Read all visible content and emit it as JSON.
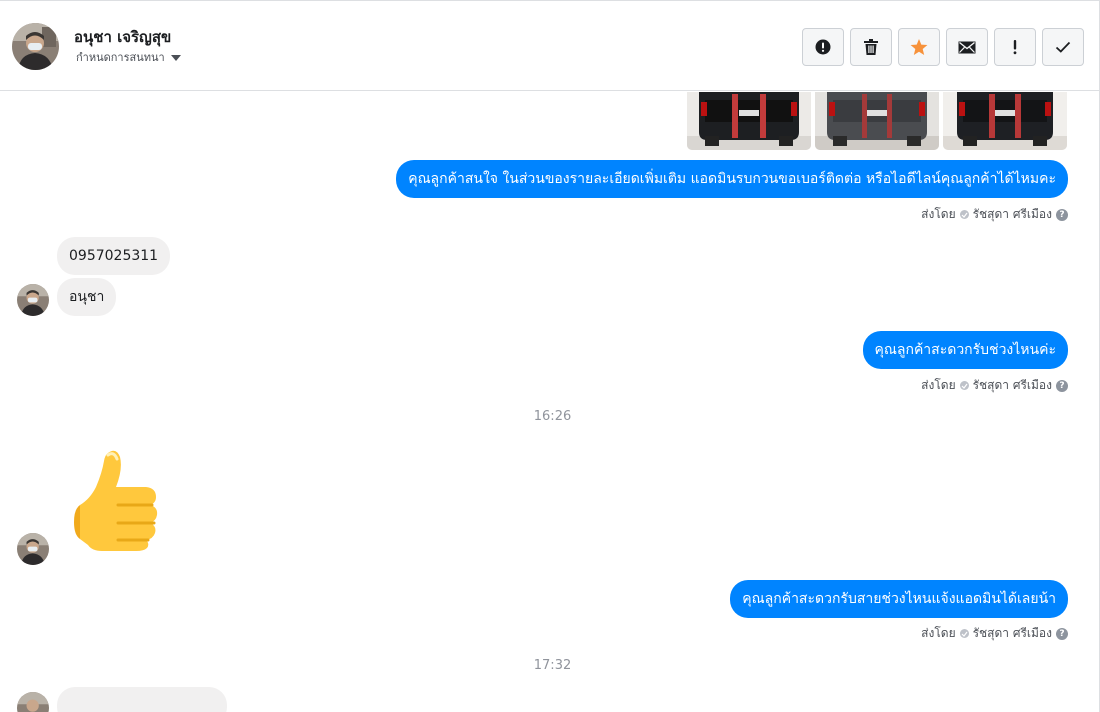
{
  "header": {
    "contact_name": "อนุชา เจริญสุข",
    "assign_label": "กำหนดการสนทนา"
  },
  "toolbar": {
    "buttons": [
      {
        "icon": "alert-circle-icon"
      },
      {
        "icon": "trash-icon"
      },
      {
        "icon": "star-icon",
        "color": "#f7923b"
      },
      {
        "icon": "envelope-icon"
      },
      {
        "icon": "exclamation-icon"
      },
      {
        "icon": "checkmark-icon"
      }
    ]
  },
  "thread": {
    "photos": [
      {
        "name": "black-pickup-truck-rear-photo-1"
      },
      {
        "name": "gray-pickup-truck-rear-photo"
      },
      {
        "name": "black-pickup-truck-rear-photo-2"
      }
    ],
    "messages": [
      {
        "direction": "out",
        "text": "คุณลูกค้าสนใจ ในส่วนของรายละเอียดเพิ่มเติม แอดมินรบกวนขอเบอร์ติดต่อ หรือไอดีไลน์คุณลูกค้าได้ไหมคะ",
        "sent_by_label": "ส่งโดย",
        "sender": "รัชสุดา ศรีเมือง"
      },
      {
        "direction": "in",
        "text": "0957025311"
      },
      {
        "direction": "in",
        "text": "อนุชา"
      },
      {
        "direction": "out",
        "text": "คุณลูกค้าสะดวกรับช่วงไหนค่ะ",
        "sent_by_label": "ส่งโดย",
        "sender": "รัชสุดา ศรีเมือง"
      },
      {
        "direction": "time",
        "text": "16:26"
      },
      {
        "direction": "in",
        "sticker": "thumbs-up-sticker"
      },
      {
        "direction": "out",
        "text": "คุณลูกค้าสะดวกรับสายช่วงไหนแจ้งแอดมินได้เลยน้า",
        "sent_by_label": "ส่งโดย",
        "sender": "รัชสุดา ศรีเมือง"
      },
      {
        "direction": "time",
        "text": "17:32"
      }
    ]
  },
  "colors": {
    "outgoing_bubble": "#0084ff",
    "incoming_bubble": "#f1f0f0",
    "star": "#f7923b",
    "thumb": "#ffc83d"
  }
}
